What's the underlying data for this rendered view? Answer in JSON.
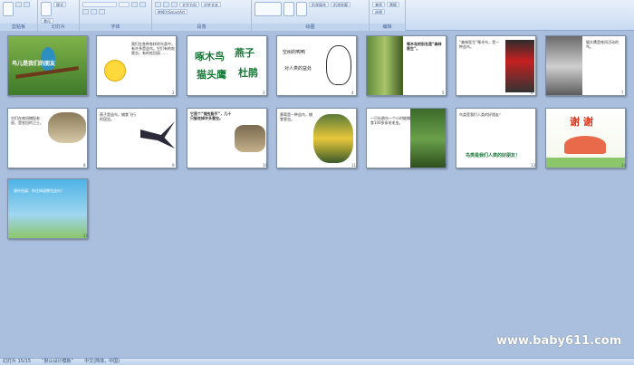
{
  "ribbon": {
    "groups": [
      {
        "label": "剪贴板",
        "buttons": [
          "粘贴"
        ]
      },
      {
        "label": "幻灯片",
        "buttons": [
          "新建幻灯片",
          "版式",
          "重设",
          "删除"
        ]
      },
      {
        "label": "字体",
        "buttons": [
          "B",
          "I",
          "U",
          "S",
          "A"
        ]
      },
      {
        "label": "段落",
        "buttons": [
          "文字方向",
          "对齐文本",
          "转换为SmartArt"
        ]
      },
      {
        "label": "绘图",
        "buttons": [
          "排列",
          "快速样式",
          "形状填充",
          "形状轮廓",
          "形状效果"
        ]
      },
      {
        "label": "编辑",
        "buttons": [
          "查找",
          "替换",
          "选择"
        ]
      }
    ]
  },
  "slides": [
    {
      "num": "1",
      "title": "鸟儿是我们的朋友"
    },
    {
      "num": "2",
      "text": "我们在各种各样的鸟类中，有许多是益鸟。它们有的吃害虫，有的吃田鼠……"
    },
    {
      "num": "3",
      "words": [
        "啄木鸟",
        "燕子",
        "猫头鹰",
        "杜鹃"
      ]
    },
    {
      "num": "4",
      "title": "空树的鸭鸭",
      "subtitle": "对人类的益处"
    },
    {
      "num": "5",
      "text": "啄木鸟的别名是“森林医生”。"
    },
    {
      "num": "6",
      "text": "“森林医生”啄木鸟，是一种益鸟。"
    },
    {
      "num": "7",
      "text": "猫头鹰是夜间活动的鸟。"
    },
    {
      "num": "8",
      "text": "它们在夜间捕捉老鼠，是农田的卫士。"
    },
    {
      "num": "9",
      "text": "燕子是益鸟，捕食飞行的昆虫。"
    },
    {
      "num": "10",
      "text": "它是个“捕虫能手”，几十只能吃掉许多害虫。"
    },
    {
      "num": "11",
      "text": "黄莺是一种益鸟，捕食害虫。"
    },
    {
      "num": "12",
      "text": "一只杜鹃鸟一个小时能捕食100多条毛毛虫。"
    },
    {
      "num": "13",
      "text": "鸟类是我们人类的好朋友！",
      "link": "鸟类是我们人类的好朋友！"
    },
    {
      "num": "14",
      "title": "谢 谢"
    },
    {
      "num": "15",
      "text": "课外拓展：你还知道哪些益鸟？"
    }
  ],
  "watermark": "www.baby611.com",
  "status": {
    "slide": "幻灯片 15/15",
    "theme": "“默认设计模板”",
    "lang": "中文(简体，中国)"
  }
}
